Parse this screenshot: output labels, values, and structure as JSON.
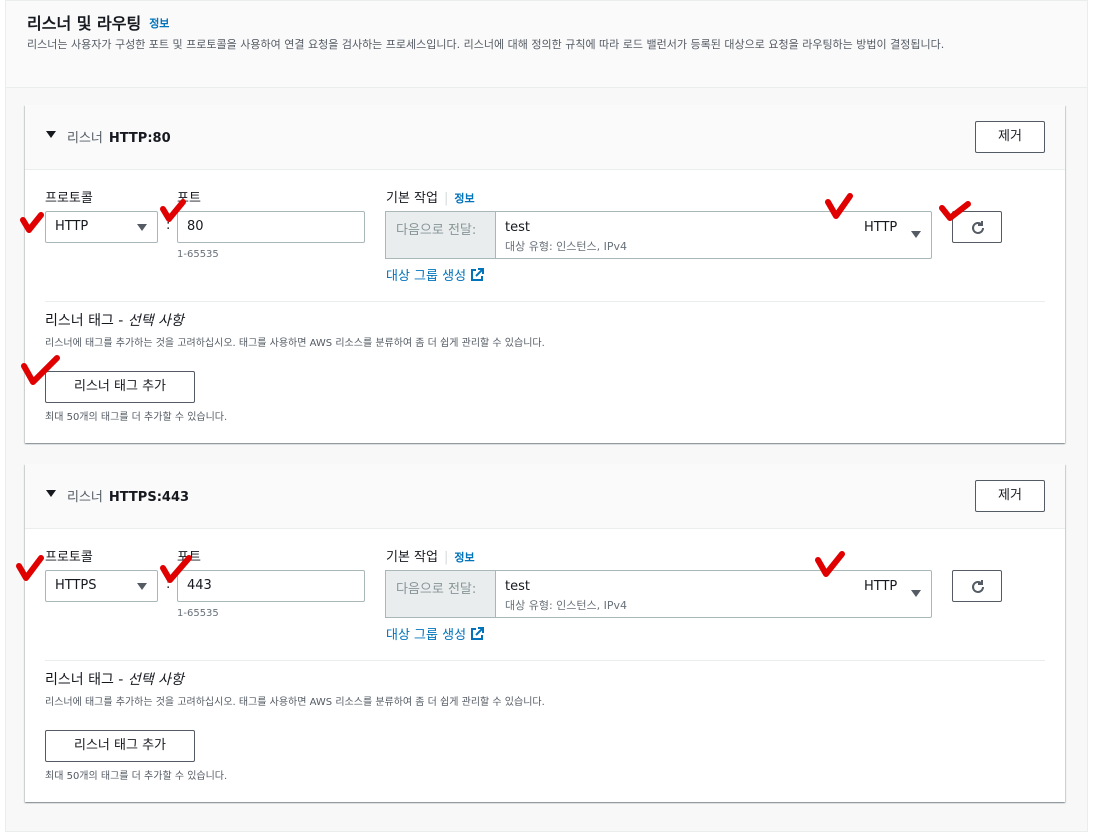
{
  "section": {
    "title": "리스너 및 라우팅",
    "info": "정보",
    "description": "리스너는 사용자가 구성한 포트 및 프로토콜을 사용하여 연결 요청을 검사하는 프로세스입니다. 리스너에 대해 정의한 규칙에 따라 로드 밸런서가 등록된 대상으로 요청을 라우팅하는 방법이 결정됩니다."
  },
  "listeners": [
    {
      "label": "리스너",
      "name": "HTTP:80",
      "remove": "제거",
      "protocol_label": "프로토콜",
      "protocol": "HTTP",
      "colon": ":",
      "port_label": "포트",
      "port": "80",
      "port_hint": "1-65535",
      "default_action_label": "기본 작업",
      "info": "정보",
      "forward_label": "다음으로 전달:",
      "target_group": "test",
      "target_group_sub": "대상 유형: 인스턴스, IPv4",
      "target_protocol": "HTTP",
      "create_tg": "대상 그룹 생성",
      "tags_title": "리스너 태그 - ",
      "tags_optional": "선택 사항",
      "tags_desc": "리스너에 태그를 추가하는 것을 고려하십시오. 태그를 사용하면 AWS 리소스를 분류하여 좀 더 쉽게 관리할 수 있습니다.",
      "add_tag": "리스너 태그 추가",
      "tag_limit": "최대 50개의 태그를 더 추가할 수 있습니다."
    },
    {
      "label": "리스너",
      "name": "HTTPS:443",
      "remove": "제거",
      "protocol_label": "프로토콜",
      "protocol": "HTTPS",
      "colon": ":",
      "port_label": "포트",
      "port": "443",
      "port_hint": "1-65535",
      "default_action_label": "기본 작업",
      "info": "정보",
      "forward_label": "다음으로 전달:",
      "target_group": "test",
      "target_group_sub": "대상 유형: 인스턴스, IPv4",
      "target_protocol": "HTTP",
      "create_tg": "대상 그룹 생성",
      "tags_title": "리스너 태그 - ",
      "tags_optional": "선택 사항",
      "tags_desc": "리스너에 태그를 추가하는 것을 고려하십시오. 태그를 사용하면 AWS 리소스를 분류하여 좀 더 쉽게 관리할 수 있습니다.",
      "add_tag": "리스너 태그 추가",
      "tag_limit": "최대 50개의 태그를 더 추가할 수 있습니다."
    }
  ],
  "icons": {
    "expand": "caret-down-icon",
    "refresh": "refresh-icon",
    "external": "external-link-icon",
    "annotation": "red-checkmark-icon"
  },
  "colors": {
    "link": "#0073bb",
    "annotation": "#e00000",
    "border": "#aab7b8"
  }
}
